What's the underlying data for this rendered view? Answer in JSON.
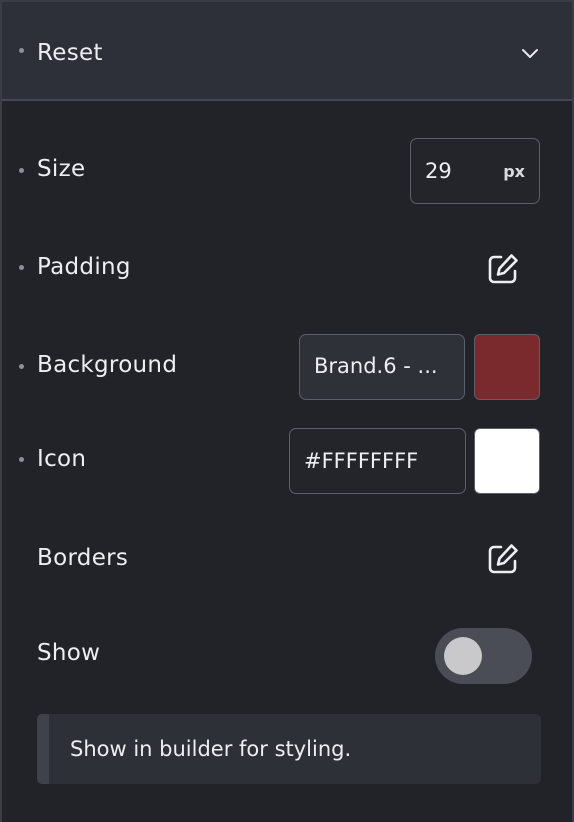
{
  "header": {
    "title": "Reset"
  },
  "size": {
    "label": "Size",
    "value": "29",
    "unit": "px"
  },
  "padding": {
    "label": "Padding"
  },
  "background": {
    "label": "Background",
    "value": "Brand.6 - ...",
    "swatch_color": "#7a2a2d"
  },
  "icon_row": {
    "label": "Icon",
    "value": "#FFFFFFFF",
    "swatch_color": "#FFFFFF"
  },
  "borders": {
    "label": "Borders"
  },
  "show": {
    "label": "Show",
    "enabled": false
  },
  "note": {
    "text": "Show in builder for styling."
  },
  "icons": {
    "collapse": "chevron-down-icon",
    "edit": "edit-square-icon"
  }
}
